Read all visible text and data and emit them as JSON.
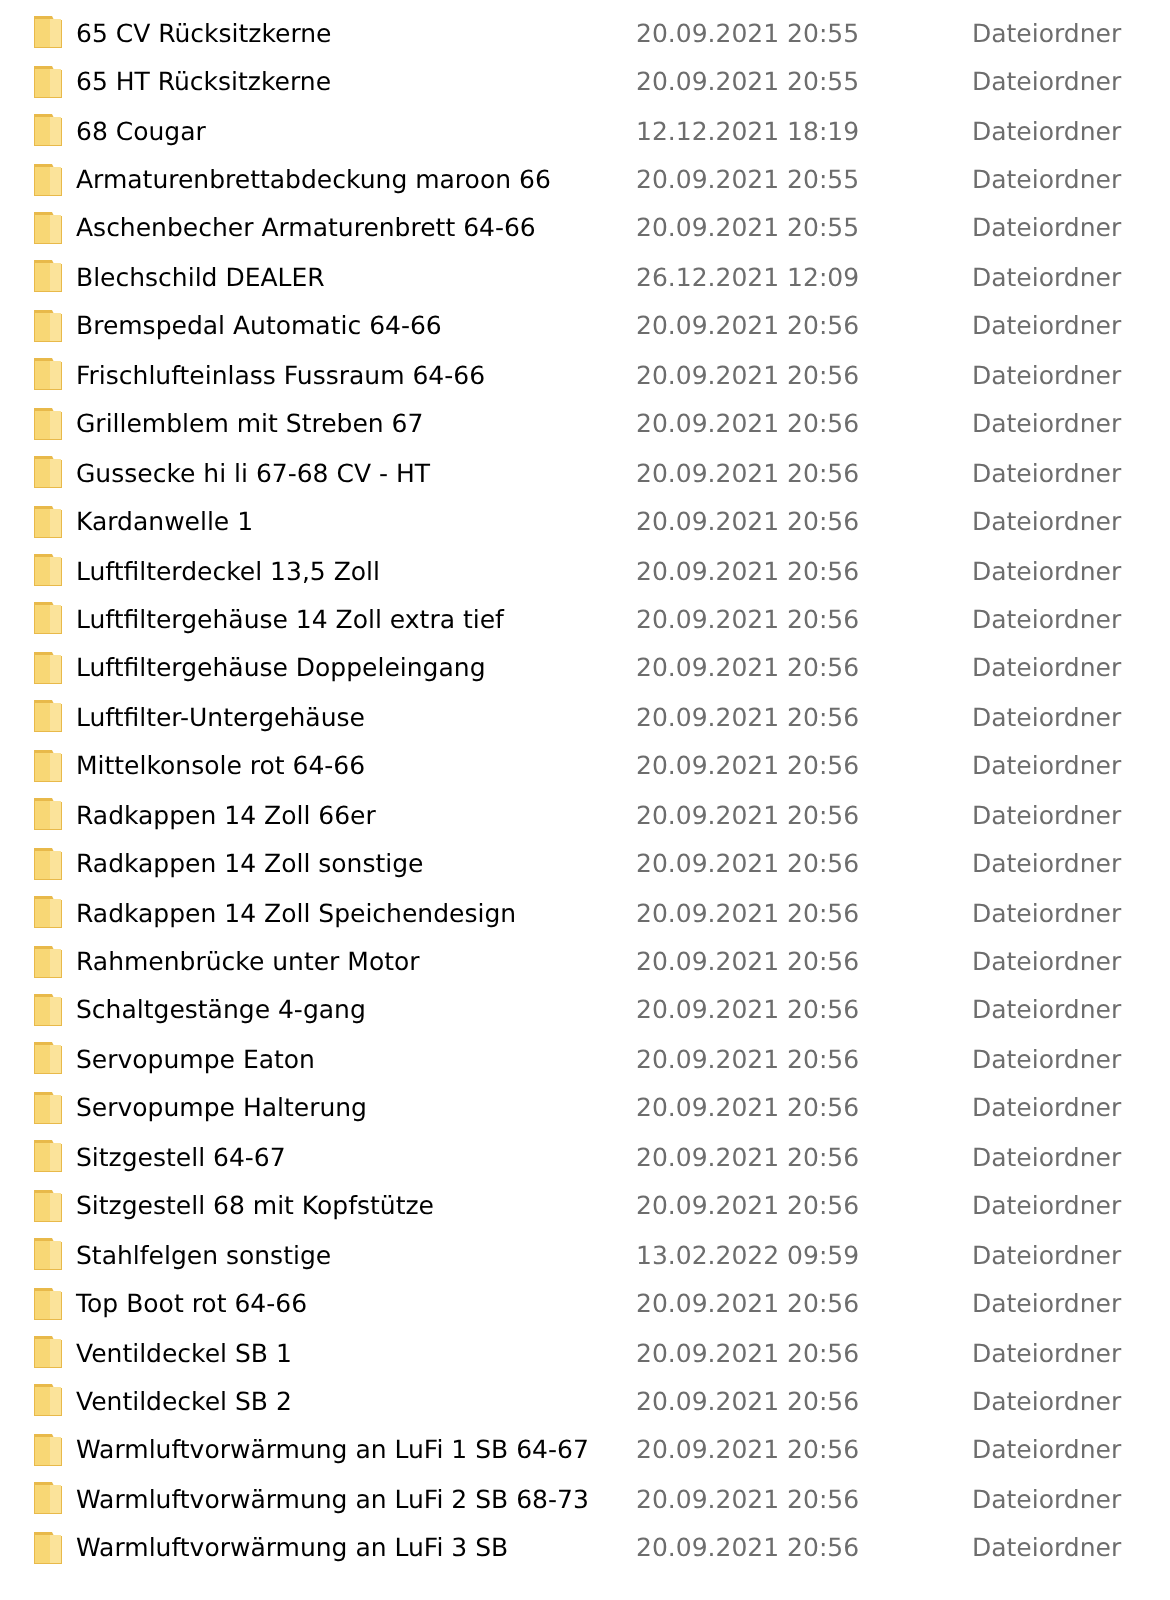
{
  "rows": [
    {
      "name": "65 CV Rücksitzkerne",
      "modified": "20.09.2021 20:55",
      "type": "Dateiordner"
    },
    {
      "name": "65 HT Rücksitzkerne",
      "modified": "20.09.2021 20:55",
      "type": "Dateiordner"
    },
    {
      "name": "68 Cougar",
      "modified": "12.12.2021 18:19",
      "type": "Dateiordner"
    },
    {
      "name": "Armaturenbrettabdeckung maroon 66",
      "modified": "20.09.2021 20:55",
      "type": "Dateiordner"
    },
    {
      "name": "Aschenbecher Armaturenbrett 64-66",
      "modified": "20.09.2021 20:55",
      "type": "Dateiordner"
    },
    {
      "name": "Blechschild DEALER",
      "modified": "26.12.2021 12:09",
      "type": "Dateiordner"
    },
    {
      "name": "Bremspedal Automatic 64-66",
      "modified": "20.09.2021 20:56",
      "type": "Dateiordner"
    },
    {
      "name": "Frischlufteinlass Fussraum 64-66",
      "modified": "20.09.2021 20:56",
      "type": "Dateiordner"
    },
    {
      "name": "Grillemblem mit Streben 67",
      "modified": "20.09.2021 20:56",
      "type": "Dateiordner"
    },
    {
      "name": "Gussecke hi li 67-68 CV - HT",
      "modified": "20.09.2021 20:56",
      "type": "Dateiordner"
    },
    {
      "name": "Kardanwelle 1",
      "modified": "20.09.2021 20:56",
      "type": "Dateiordner"
    },
    {
      "name": "Luftfilterdeckel 13,5 Zoll",
      "modified": "20.09.2021 20:56",
      "type": "Dateiordner"
    },
    {
      "name": "Luftfiltergehäuse 14 Zoll extra tief",
      "modified": "20.09.2021 20:56",
      "type": "Dateiordner"
    },
    {
      "name": "Luftfiltergehäuse Doppeleingang",
      "modified": "20.09.2021 20:56",
      "type": "Dateiordner"
    },
    {
      "name": "Luftfilter-Untergehäuse",
      "modified": "20.09.2021 20:56",
      "type": "Dateiordner"
    },
    {
      "name": "Mittelkonsole rot 64-66",
      "modified": "20.09.2021 20:56",
      "type": "Dateiordner"
    },
    {
      "name": "Radkappen 14 Zoll 66er",
      "modified": "20.09.2021 20:56",
      "type": "Dateiordner"
    },
    {
      "name": "Radkappen 14 Zoll sonstige",
      "modified": "20.09.2021 20:56",
      "type": "Dateiordner"
    },
    {
      "name": "Radkappen 14 Zoll Speichendesign",
      "modified": "20.09.2021 20:56",
      "type": "Dateiordner"
    },
    {
      "name": "Rahmenbrücke unter Motor",
      "modified": "20.09.2021 20:56",
      "type": "Dateiordner"
    },
    {
      "name": "Schaltgestänge 4-gang",
      "modified": "20.09.2021 20:56",
      "type": "Dateiordner"
    },
    {
      "name": "Servopumpe Eaton",
      "modified": "20.09.2021 20:56",
      "type": "Dateiordner"
    },
    {
      "name": "Servopumpe Halterung",
      "modified": "20.09.2021 20:56",
      "type": "Dateiordner"
    },
    {
      "name": "Sitzgestell 64-67",
      "modified": "20.09.2021 20:56",
      "type": "Dateiordner"
    },
    {
      "name": "Sitzgestell 68 mit Kopfstütze",
      "modified": "20.09.2021 20:56",
      "type": "Dateiordner"
    },
    {
      "name": "Stahlfelgen sonstige",
      "modified": "13.02.2022 09:59",
      "type": "Dateiordner"
    },
    {
      "name": "Top Boot rot 64-66",
      "modified": "20.09.2021 20:56",
      "type": "Dateiordner"
    },
    {
      "name": "Ventildeckel SB 1",
      "modified": "20.09.2021 20:56",
      "type": "Dateiordner"
    },
    {
      "name": "Ventildeckel SB 2",
      "modified": "20.09.2021 20:56",
      "type": "Dateiordner"
    },
    {
      "name": "Warmluftvorwärmung an LuFi 1 SB 64-67",
      "modified": "20.09.2021 20:56",
      "type": "Dateiordner"
    },
    {
      "name": "Warmluftvorwärmung an LuFi 2 SB 68-73",
      "modified": "20.09.2021 20:56",
      "type": "Dateiordner"
    },
    {
      "name": "Warmluftvorwärmung an LuFi 3 SB",
      "modified": "20.09.2021 20:56",
      "type": "Dateiordner"
    }
  ]
}
